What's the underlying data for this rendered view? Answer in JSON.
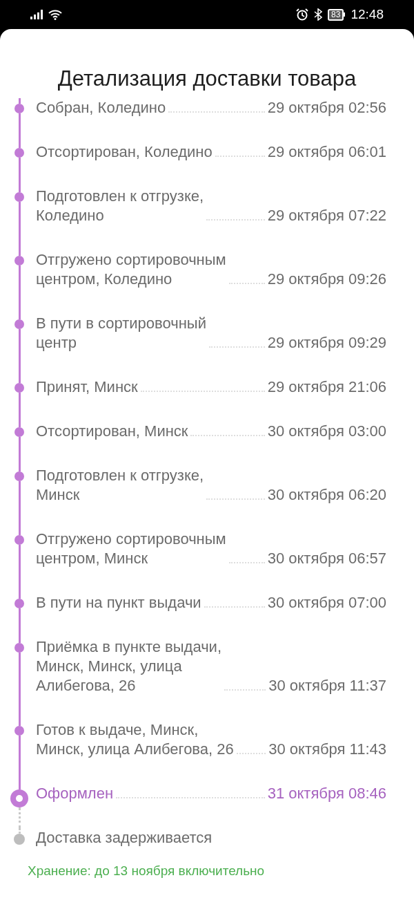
{
  "status_bar": {
    "battery": "83",
    "time": "12:48"
  },
  "title": "Детализация доставки товара",
  "events": [
    {
      "label": "Собран, Коледино",
      "date": "29 октября 02:56",
      "kind": "past"
    },
    {
      "label": "Отсортирован, Коледино",
      "date": "29 октября 06:01",
      "kind": "past"
    },
    {
      "label": "Подготовлен к отгрузке,\nКоледино",
      "date": "29 октября 07:22",
      "kind": "past"
    },
    {
      "label": "Отгружено сортировочным\nцентром, Коледино",
      "date": "29 октября 09:26",
      "kind": "past"
    },
    {
      "label": "В пути в сортировочный\nцентр",
      "date": "29 октября 09:29",
      "kind": "past"
    },
    {
      "label": "Принят, Минск",
      "date": "29 октября 21:06",
      "kind": "past"
    },
    {
      "label": "Отсортирован, Минск",
      "date": "30 октября 03:00",
      "kind": "past"
    },
    {
      "label": "Подготовлен к отгрузке,\nМинск",
      "date": "30 октября 06:20",
      "kind": "past"
    },
    {
      "label": "Отгружено сортировочным\nцентром, Минск",
      "date": "30 октября 06:57",
      "kind": "past"
    },
    {
      "label": "В пути на пункт выдачи",
      "date": "30 октября 07:00",
      "kind": "past"
    },
    {
      "label": "Приёмка в пункте выдачи,\nМинск, Минск, улица\nАлибегова, 26",
      "date": "30 октября 11:37",
      "kind": "past"
    },
    {
      "label": "Готов к выдаче, Минск,\nМинск, улица Алибегова, 26",
      "date": "30 октября 11:43",
      "kind": "past"
    },
    {
      "label": "Оформлен",
      "date": "31 октября 08:46",
      "kind": "current"
    },
    {
      "label": "Доставка задерживается",
      "kind": "future"
    }
  ],
  "storage_note": "Хранение: до 13 ноября включительно"
}
